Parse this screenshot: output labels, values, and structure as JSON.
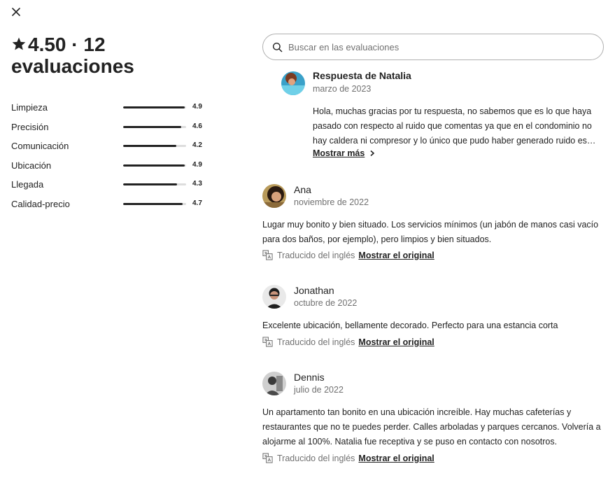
{
  "dialog": {
    "close_icon": "close-icon"
  },
  "summary": {
    "rating": "4.50",
    "separator": "·",
    "count_label": "12 evaluaciones",
    "star_icon": "star-icon"
  },
  "categories": [
    {
      "label": "Limpieza",
      "value": "4.9",
      "score": 4.9
    },
    {
      "label": "Precisión",
      "value": "4.6",
      "score": 4.6
    },
    {
      "label": "Comunicación",
      "value": "4.2",
      "score": 4.2
    },
    {
      "label": "Ubicación",
      "value": "4.9",
      "score": 4.9
    },
    {
      "label": "Llegada",
      "value": "4.3",
      "score": 4.3
    },
    {
      "label": "Calidad-precio",
      "value": "4.7",
      "score": 4.7
    }
  ],
  "search": {
    "placeholder": "Buscar en las evaluaciones",
    "value": ""
  },
  "host_response": {
    "title": "Respuesta de Natalia",
    "date": "marzo de 2023",
    "text": "Hola, muchas gracias por tu respuesta, no sabemos que es lo que haya pasado con respecto al ruido que comentas ya que en el condominio no hay caldera ni compresor y lo único que pudo haber generado ruido es el...",
    "show_more": "Mostrar más"
  },
  "reviews": [
    {
      "name": "Ana",
      "date": "noviembre de 2022",
      "text": "Lugar muy bonito y bien situado. Los servicios mínimos (un jabón de manos casi vacío para dos baños, por ejemplo), pero limpios y bien situados.",
      "translated": "Traducido del inglés",
      "show_original": "Mostrar el original"
    },
    {
      "name": "Jonathan",
      "date": "octubre de 2022",
      "text": "Excelente ubicación, bellamente decorado. Perfecto para una estancia corta",
      "translated": "Traducido del inglés",
      "show_original": "Mostrar el original"
    },
    {
      "name": "Dennis",
      "date": "julio de 2022",
      "text": "Un apartamento tan bonito en una ubicación increíble. Hay muchas cafeterías y restaurantes que no te puedes perder. Calles arboladas y parques cercanos. Volvería a alojarme al 100%. Natalia fue receptiva y se puso en contacto con nosotros.",
      "translated": "Traducido del inglés",
      "show_original": "Mostrar el original"
    }
  ],
  "colors": {
    "text": "#222222",
    "muted": "#717171",
    "track": "#dddddd",
    "border": "#b0b0b0"
  }
}
